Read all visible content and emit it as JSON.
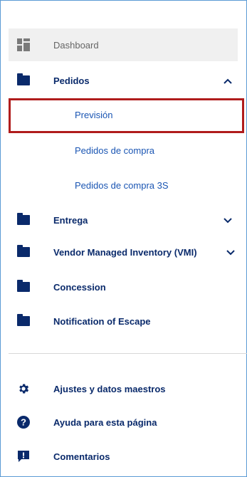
{
  "nav": {
    "dashboard": "Dashboard",
    "pedidos": "Pedidos",
    "pedidos_sub": [
      "Previsión",
      "Pedidos de compra",
      "Pedidos de compra 3S"
    ],
    "entrega": "Entrega",
    "vmi": "Vendor Managed Inventory (VMI)",
    "concession": "Concession",
    "notification": "Notification of Escape"
  },
  "footer": {
    "settings": "Ajustes y datos maestros",
    "help": "Ayuda para esta página",
    "comments": "Comentarios"
  },
  "colors": {
    "primary": "#0a2a6b",
    "link": "#1a55b3",
    "highlight": "#b01c1c",
    "active_bg": "#f0f0f0"
  }
}
